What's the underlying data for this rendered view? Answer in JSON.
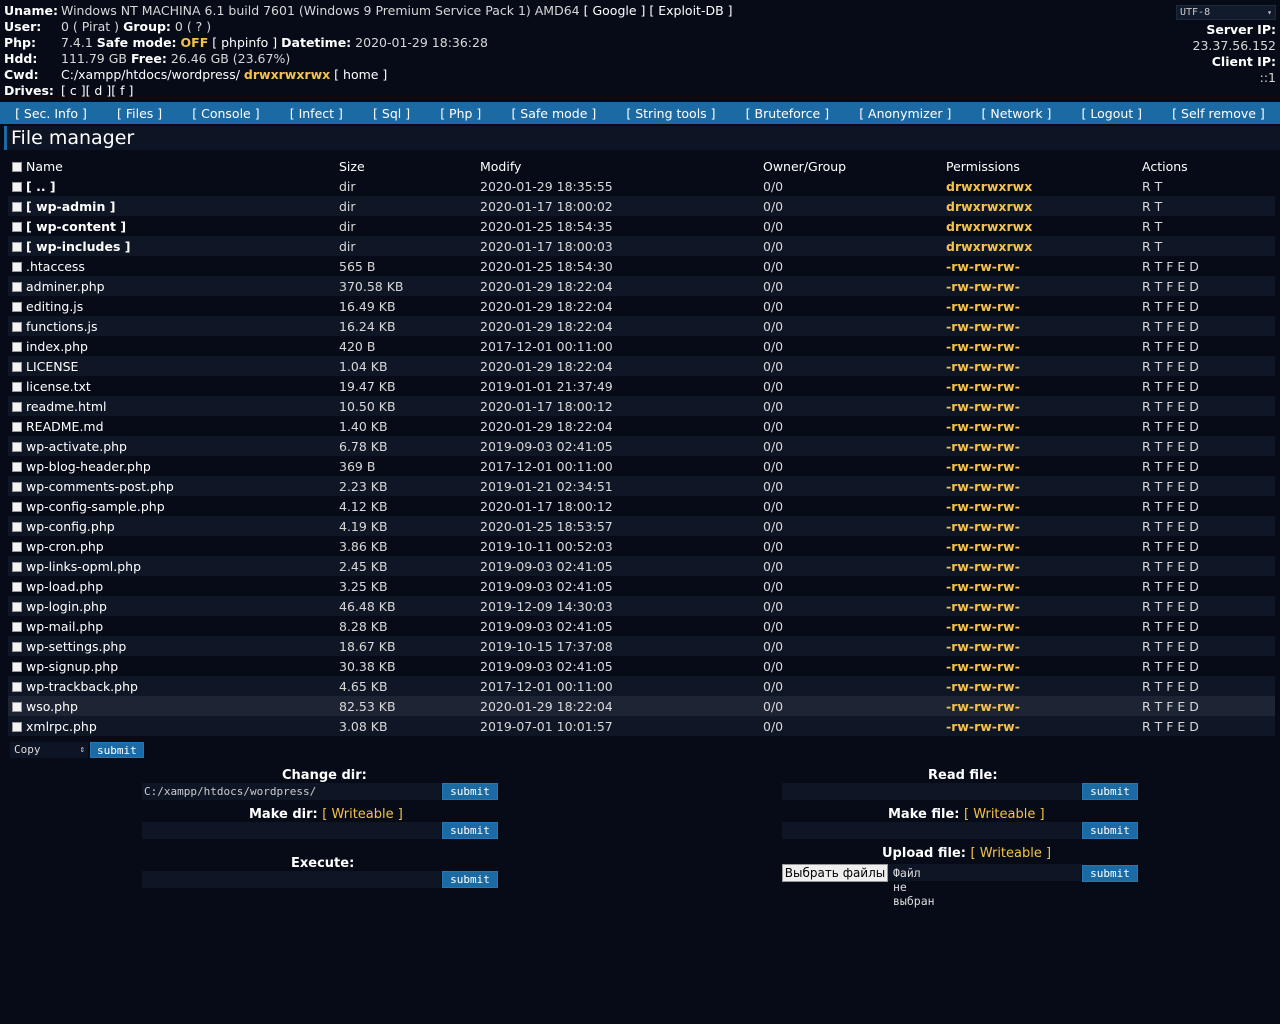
{
  "info": {
    "uname_label": "Uname:",
    "uname": "Windows NT MACHINA 6.1 build 7601 (Windows 9 Premium Service Pack 1) AMD64",
    "google": "[ Google ]",
    "exploitdb": "[ Exploit-DB ]",
    "user_label": "User:",
    "user": "0 ( Pirat )",
    "group_label": "Group:",
    "group": "0 ( ? )",
    "php_label": "Php:",
    "php_version": "7.4.1",
    "safe_mode_label": "Safe mode:",
    "safe_mode": "OFF",
    "phpinfo": "[ phpinfo ]",
    "datetime_label": "Datetime:",
    "datetime": "2020-01-29 18:36:28",
    "hdd_label": "Hdd:",
    "hdd": "111.79 GB",
    "free_label": "Free:",
    "free": "26.46 GB (23.67%)",
    "cwd_label": "Cwd:",
    "cwd": "C:/xampp/htdocs/wordpress/",
    "cwd_perms": "drwxrwxrwx",
    "home": "[ home ]",
    "drives_label": "Drives:",
    "drives": [
      "[ c ]",
      "[ d ]",
      "[ f ]"
    ]
  },
  "right": {
    "encoding": "UTF-8",
    "server_ip_label": "Server IP:",
    "server_ip": "23.37.56.152",
    "client_ip_label": "Client IP:",
    "client_ip": "::1"
  },
  "menu": [
    "[ Sec. Info ]",
    "[ Files ]",
    "[ Console ]",
    "[ Infect ]",
    "[ Sql ]",
    "[ Php ]",
    "[ Safe mode ]",
    "[ String tools ]",
    "[ Bruteforce ]",
    "[ Anonymizer ]",
    "[ Network ]",
    "[ Logout ]",
    "[ Self remove ]"
  ],
  "page_title": "File manager",
  "columns": [
    "Name",
    "Size",
    "Modify",
    "Owner/Group",
    "Permissions",
    "Actions"
  ],
  "files": [
    {
      "name": "[ .. ]",
      "size": "dir",
      "modify": "2020-01-29 18:35:55",
      "owner": "0/0",
      "perms": "drwxrwxrwx",
      "actions": "R T",
      "dir": true
    },
    {
      "name": "[ wp-admin ]",
      "size": "dir",
      "modify": "2020-01-17 18:00:02",
      "owner": "0/0",
      "perms": "drwxrwxrwx",
      "actions": "R T",
      "dir": true
    },
    {
      "name": "[ wp-content ]",
      "size": "dir",
      "modify": "2020-01-25 18:54:35",
      "owner": "0/0",
      "perms": "drwxrwxrwx",
      "actions": "R T",
      "dir": true
    },
    {
      "name": "[ wp-includes ]",
      "size": "dir",
      "modify": "2020-01-17 18:00:03",
      "owner": "0/0",
      "perms": "drwxrwxrwx",
      "actions": "R T",
      "dir": true
    },
    {
      "name": ".htaccess",
      "size": "565 B",
      "modify": "2020-01-25 18:54:30",
      "owner": "0/0",
      "perms": "-rw-rw-rw-",
      "actions": "R T F E D"
    },
    {
      "name": "adminer.php",
      "size": "370.58 KB",
      "modify": "2020-01-29 18:22:04",
      "owner": "0/0",
      "perms": "-rw-rw-rw-",
      "actions": "R T F E D"
    },
    {
      "name": "editing.js",
      "size": "16.49 KB",
      "modify": "2020-01-29 18:22:04",
      "owner": "0/0",
      "perms": "-rw-rw-rw-",
      "actions": "R T F E D"
    },
    {
      "name": "functions.js",
      "size": "16.24 KB",
      "modify": "2020-01-29 18:22:04",
      "owner": "0/0",
      "perms": "-rw-rw-rw-",
      "actions": "R T F E D"
    },
    {
      "name": "index.php",
      "size": "420 B",
      "modify": "2017-12-01 00:11:00",
      "owner": "0/0",
      "perms": "-rw-rw-rw-",
      "actions": "R T F E D"
    },
    {
      "name": "LICENSE",
      "size": "1.04 KB",
      "modify": "2020-01-29 18:22:04",
      "owner": "0/0",
      "perms": "-rw-rw-rw-",
      "actions": "R T F E D"
    },
    {
      "name": "license.txt",
      "size": "19.47 KB",
      "modify": "2019-01-01 21:37:49",
      "owner": "0/0",
      "perms": "-rw-rw-rw-",
      "actions": "R T F E D"
    },
    {
      "name": "readme.html",
      "size": "10.50 KB",
      "modify": "2020-01-17 18:00:12",
      "owner": "0/0",
      "perms": "-rw-rw-rw-",
      "actions": "R T F E D"
    },
    {
      "name": "README.md",
      "size": "1.40 KB",
      "modify": "2020-01-29 18:22:04",
      "owner": "0/0",
      "perms": "-rw-rw-rw-",
      "actions": "R T F E D"
    },
    {
      "name": "wp-activate.php",
      "size": "6.78 KB",
      "modify": "2019-09-03 02:41:05",
      "owner": "0/0",
      "perms": "-rw-rw-rw-",
      "actions": "R T F E D"
    },
    {
      "name": "wp-blog-header.php",
      "size": "369 B",
      "modify": "2017-12-01 00:11:00",
      "owner": "0/0",
      "perms": "-rw-rw-rw-",
      "actions": "R T F E D"
    },
    {
      "name": "wp-comments-post.php",
      "size": "2.23 KB",
      "modify": "2019-01-21 02:34:51",
      "owner": "0/0",
      "perms": "-rw-rw-rw-",
      "actions": "R T F E D"
    },
    {
      "name": "wp-config-sample.php",
      "size": "4.12 KB",
      "modify": "2020-01-17 18:00:12",
      "owner": "0/0",
      "perms": "-rw-rw-rw-",
      "actions": "R T F E D"
    },
    {
      "name": "wp-config.php",
      "size": "4.19 KB",
      "modify": "2020-01-25 18:53:57",
      "owner": "0/0",
      "perms": "-rw-rw-rw-",
      "actions": "R T F E D"
    },
    {
      "name": "wp-cron.php",
      "size": "3.86 KB",
      "modify": "2019-10-11 00:52:03",
      "owner": "0/0",
      "perms": "-rw-rw-rw-",
      "actions": "R T F E D"
    },
    {
      "name": "wp-links-opml.php",
      "size": "2.45 KB",
      "modify": "2019-09-03 02:41:05",
      "owner": "0/0",
      "perms": "-rw-rw-rw-",
      "actions": "R T F E D"
    },
    {
      "name": "wp-load.php",
      "size": "3.25 KB",
      "modify": "2019-09-03 02:41:05",
      "owner": "0/0",
      "perms": "-rw-rw-rw-",
      "actions": "R T F E D"
    },
    {
      "name": "wp-login.php",
      "size": "46.48 KB",
      "modify": "2019-12-09 14:30:03",
      "owner": "0/0",
      "perms": "-rw-rw-rw-",
      "actions": "R T F E D"
    },
    {
      "name": "wp-mail.php",
      "size": "8.28 KB",
      "modify": "2019-09-03 02:41:05",
      "owner": "0/0",
      "perms": "-rw-rw-rw-",
      "actions": "R T F E D"
    },
    {
      "name": "wp-settings.php",
      "size": "18.67 KB",
      "modify": "2019-10-15 17:37:08",
      "owner": "0/0",
      "perms": "-rw-rw-rw-",
      "actions": "R T F E D"
    },
    {
      "name": "wp-signup.php",
      "size": "30.38 KB",
      "modify": "2019-09-03 02:41:05",
      "owner": "0/0",
      "perms": "-rw-rw-rw-",
      "actions": "R T F E D"
    },
    {
      "name": "wp-trackback.php",
      "size": "4.65 KB",
      "modify": "2017-12-01 00:11:00",
      "owner": "0/0",
      "perms": "-rw-rw-rw-",
      "actions": "R T F E D"
    },
    {
      "name": "wso.php",
      "size": "82.53 KB",
      "modify": "2020-01-29 18:22:04",
      "owner": "0/0",
      "perms": "-rw-rw-rw-",
      "actions": "R T F E D",
      "highlight": true
    },
    {
      "name": "xmlrpc.php",
      "size": "3.08 KB",
      "modify": "2019-07-01 10:01:57",
      "owner": "0/0",
      "perms": "-rw-rw-rw-",
      "actions": "R T F E D"
    }
  ],
  "action_select": "Copy",
  "submit_label": "submit",
  "forms": {
    "change_dir_label": "Change dir:",
    "change_dir_value": "C:/xampp/htdocs/wordpress/",
    "make_dir_label": "Make dir:",
    "writeable": "[ Writeable ]",
    "execute_label": "Execute:",
    "read_file_label": "Read file:",
    "make_file_label": "Make file:",
    "upload_file_label": "Upload file:",
    "choose_files": "Выбрать файлы",
    "no_file": "Файл не выбран"
  },
  "colors": {
    "accent": "#1c6aa3",
    "background": "#060b17",
    "highlight": "#f4c24a"
  }
}
